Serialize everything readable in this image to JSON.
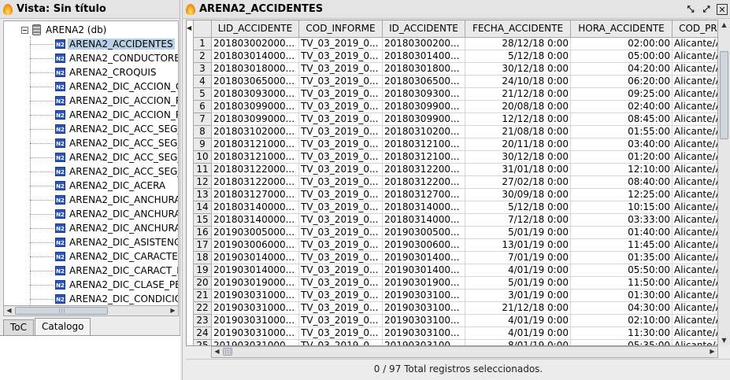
{
  "left_panel": {
    "title": "Vista: Sin título",
    "tree": {
      "root_label": "ARENA2 (db)",
      "icon_text": "N2",
      "items": [
        {
          "label": "ARENA2_ACCIDENTES",
          "selected": true
        },
        {
          "label": "ARENA2_CONDUCTORES"
        },
        {
          "label": "ARENA2_CROQUIS"
        },
        {
          "label": "ARENA2_DIC_ACCION_CO"
        },
        {
          "label": "ARENA2_DIC_ACCION_PA"
        },
        {
          "label": "ARENA2_DIC_ACCION_PE"
        },
        {
          "label": "ARENA2_DIC_ACC_SEG_C"
        },
        {
          "label": "ARENA2_DIC_ACC_SEG_C"
        },
        {
          "label": "ARENA2_DIC_ACC_SEG_P"
        },
        {
          "label": "ARENA2_DIC_ACC_SEG_P"
        },
        {
          "label": "ARENA2_DIC_ACERA"
        },
        {
          "label": "ARENA2_DIC_ANCHURA_"
        },
        {
          "label": "ARENA2_DIC_ANCHURA_"
        },
        {
          "label": "ARENA2_DIC_ANCHURA_"
        },
        {
          "label": "ARENA2_DIC_ASISTENCIA"
        },
        {
          "label": "ARENA2_DIC_CARACTER"
        },
        {
          "label": "ARENA2_DIC_CARACT_FU"
        },
        {
          "label": "ARENA2_DIC_CLASE_PER"
        },
        {
          "label": "ARENA2_DIC_CONDICION"
        }
      ]
    },
    "tabs": [
      {
        "label": "ToC",
        "active": false
      },
      {
        "label": "Catalogo",
        "active": true
      }
    ]
  },
  "table_window": {
    "title": "ARENA2_ACCIDENTES",
    "columns": [
      "LID_ACCIDENTE",
      "COD_INFORME",
      "ID_ACCIDENTE",
      "FECHA_ACCIDENTE",
      "HORA_ACCIDENTE",
      "COD_PR"
    ],
    "rows": [
      [
        "1",
        "201803002000...",
        "TV_03_2019_0...",
        "20180300200...",
        "28/12/18 0:00",
        "02:00:00",
        "Alicante/A"
      ],
      [
        "2",
        "201803014000...",
        "TV_03_2019_0...",
        "20180301400...",
        "5/12/18 0:00",
        "05:00:00",
        "Alicante/A"
      ],
      [
        "3",
        "201803018000...",
        "TV_03_2019_0...",
        "20180301800...",
        "30/12/18 0:00",
        "04:20:00",
        "Alicante/A"
      ],
      [
        "4",
        "201803065000...",
        "TV_03_2019_0...",
        "20180306500...",
        "24/10/18 0:00",
        "06:20:00",
        "Alicante/A"
      ],
      [
        "5",
        "201803093000...",
        "TV_03_2019_0...",
        "20180309300...",
        "21/12/18 0:00",
        "09:25:00",
        "Alicante/A"
      ],
      [
        "6",
        "201803099000...",
        "TV_03_2019_0...",
        "20180309900...",
        "20/08/18 0:00",
        "02:40:00",
        "Alicante/A"
      ],
      [
        "7",
        "201803099000...",
        "TV_03_2019_0...",
        "20180309900...",
        "12/12/18 0:00",
        "08:45:00",
        "Alicante/A"
      ],
      [
        "8",
        "201803102000...",
        "TV_03_2019_0...",
        "20180310200...",
        "21/08/18 0:00",
        "01:55:00",
        "Alicante/A"
      ],
      [
        "9",
        "201803121000...",
        "TV_03_2019_0...",
        "20180312100...",
        "20/11/18 0:00",
        "03:40:00",
        "Alicante/A"
      ],
      [
        "10",
        "201803121000...",
        "TV_03_2019_0...",
        "20180312100...",
        "30/12/18 0:00",
        "01:20:00",
        "Alicante/A"
      ],
      [
        "11",
        "201803122000...",
        "TV_03_2019_0...",
        "20180312200...",
        "31/01/18 0:00",
        "12:10:00",
        "Alicante/A"
      ],
      [
        "12",
        "201803122000...",
        "TV_03_2019_0...",
        "20180312200...",
        "27/02/18 0:00",
        "08:40:00",
        "Alicante/A"
      ],
      [
        "13",
        "201803127000...",
        "TV_03_2019_0...",
        "20180312700...",
        "30/09/18 0:00",
        "12:25:00",
        "Alicante/A"
      ],
      [
        "14",
        "201803140000...",
        "TV_03_2019_0...",
        "20180314000...",
        "5/12/18 0:00",
        "10:15:00",
        "Alicante/A"
      ],
      [
        "15",
        "201803140000...",
        "TV_03_2019_0...",
        "20180314000...",
        "7/12/18 0:00",
        "03:33:00",
        "Alicante/A"
      ],
      [
        "16",
        "201903005000...",
        "TV_03_2019_0...",
        "20190300500...",
        "5/01/19 0:00",
        "01:40:00",
        "Alicante/A"
      ],
      [
        "17",
        "201903006000...",
        "TV_03_2019_0...",
        "20190300600...",
        "13/01/19 0:00",
        "11:45:00",
        "Alicante/A"
      ],
      [
        "18",
        "201903014000...",
        "TV_03_2019_0...",
        "20190301400...",
        "7/01/19 0:00",
        "01:35:00",
        "Alicante/A"
      ],
      [
        "19",
        "201903014000...",
        "TV_03_2019_0...",
        "20190301400...",
        "4/01/19 0:00",
        "05:50:00",
        "Alicante/A"
      ],
      [
        "20",
        "201903019000...",
        "TV_03_2019_0...",
        "20190301900...",
        "5/01/19 0:00",
        "11:50:00",
        "Alicante/A"
      ],
      [
        "21",
        "201903031000...",
        "TV_03_2019_0...",
        "20190303100...",
        "3/01/19 0:00",
        "01:30:00",
        "Alicante/A"
      ],
      [
        "22",
        "201903031000...",
        "TV_03_2019_0...",
        "20190303100...",
        "21/12/18 0:00",
        "04:30:00",
        "Alicante/A"
      ],
      [
        "23",
        "201903031000...",
        "TV_03_2019_0...",
        "20190303100...",
        "4/01/19 0:00",
        "02:10:00",
        "Alicante/A"
      ],
      [
        "24",
        "201903031000...",
        "TV_03_2019_0...",
        "20190303100...",
        "4/01/19 0:00",
        "11:30:00",
        "Alicante/A"
      ],
      [
        "25",
        "201903031000...",
        "TV_03_2019_0...",
        "20190303100...",
        "8/01/19 0:00",
        "05:35:00",
        "Alicante/A"
      ]
    ],
    "status": "0 / 97 Total registros seleccionados."
  }
}
